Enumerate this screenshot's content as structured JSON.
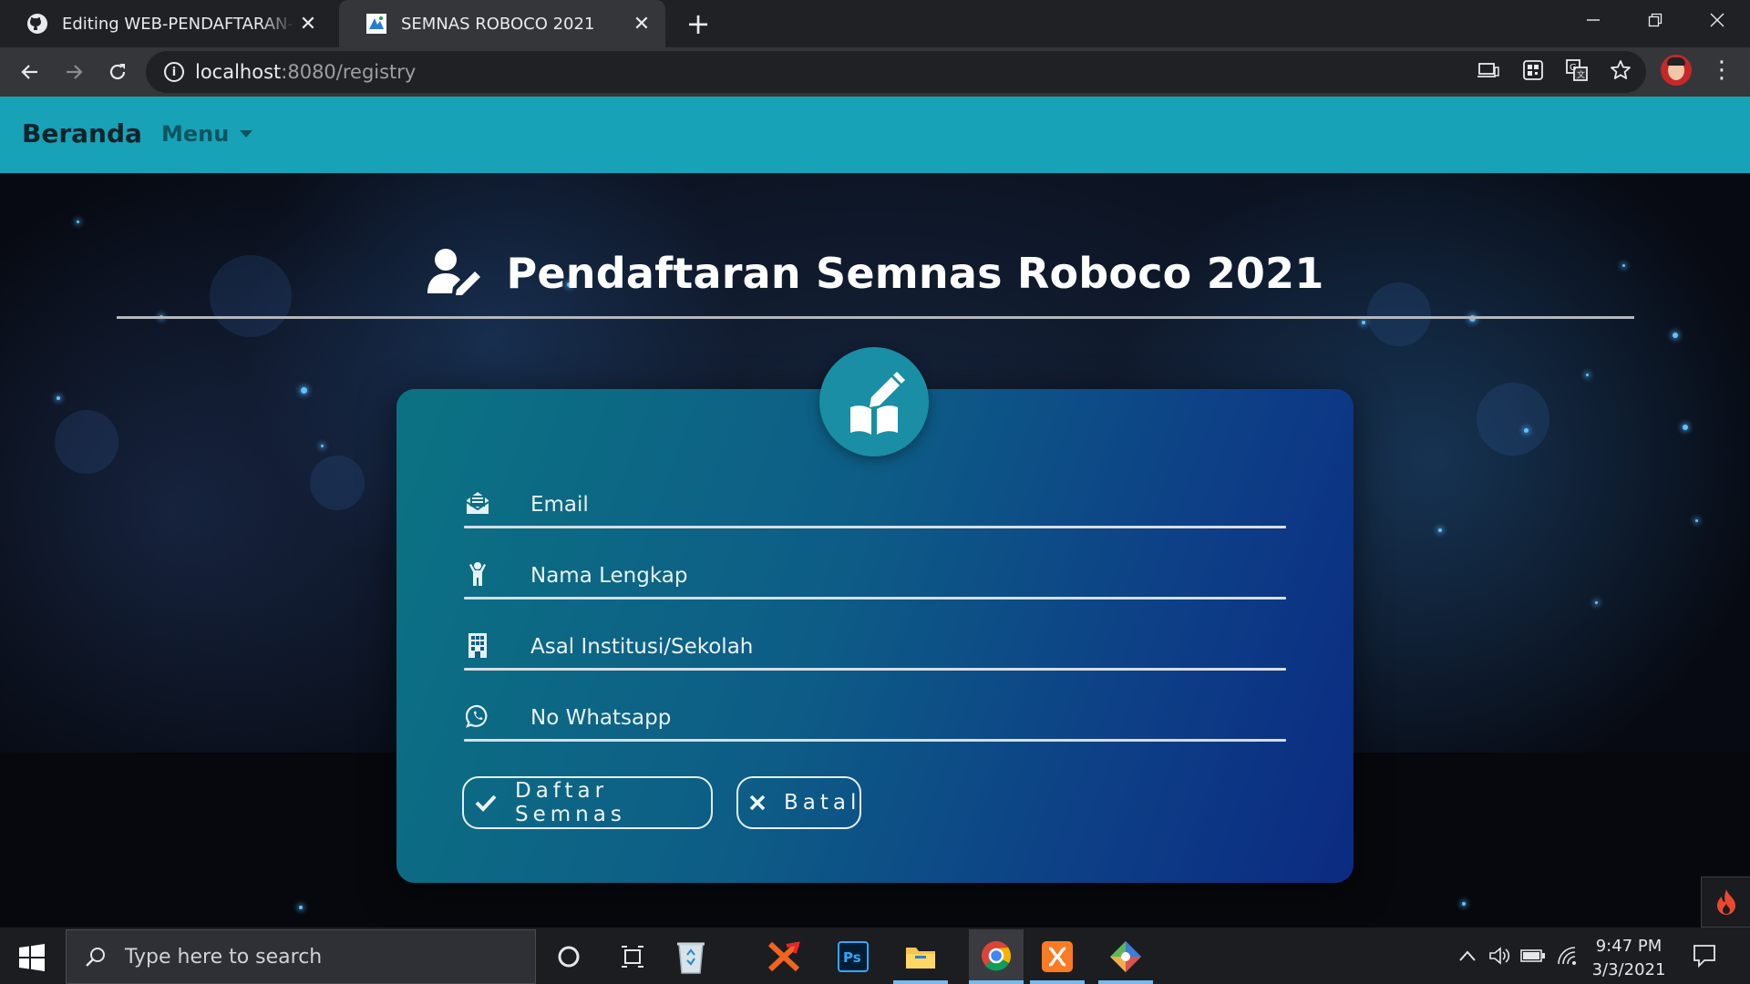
{
  "browser": {
    "tabs": [
      {
        "title": "Editing WEB-PENDAFTARAN-CODEIGNITER",
        "active": false
      },
      {
        "title": "SEMNAS ROBOCO 2021",
        "active": true
      }
    ],
    "new_tab_label": "+",
    "address": {
      "host": "localhost",
      "rest": ":8080/registry"
    }
  },
  "navbar": {
    "brand": "Beranda",
    "menu_label": "Menu",
    "background": "#17a2b8"
  },
  "page": {
    "heading": "Pendaftaran Semnas Roboco 2021",
    "form": {
      "fields": [
        {
          "label": "Email",
          "icon": "envelope-open-icon"
        },
        {
          "label": "Nama Lengkap",
          "icon": "child-person-icon"
        },
        {
          "label": "Asal Institusi/Sekolah",
          "icon": "building-icon"
        },
        {
          "label": "No Whatsapp",
          "icon": "whatsapp-icon"
        }
      ],
      "submit_label": "Daftar Semnas",
      "cancel_label": "Batal"
    }
  },
  "taskbar": {
    "search_placeholder": "Type here to search",
    "time": "9:47 PM",
    "date": "3/3/2021"
  }
}
